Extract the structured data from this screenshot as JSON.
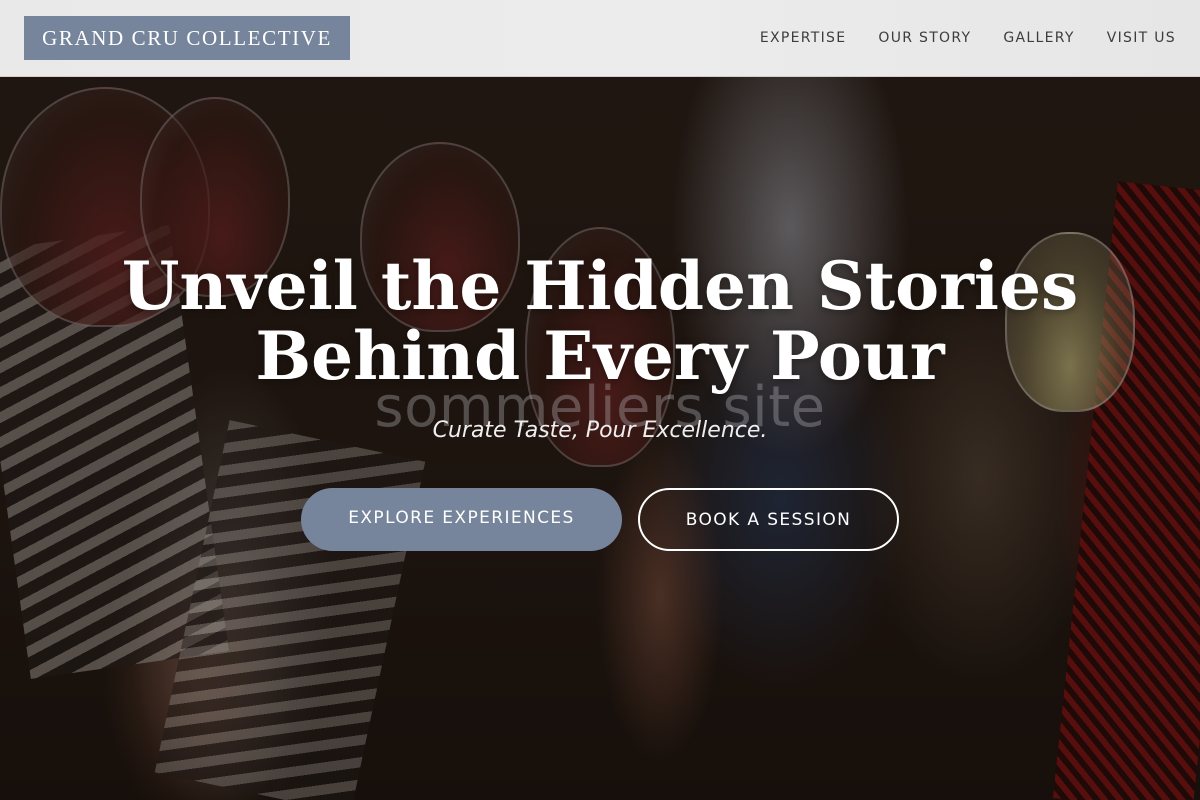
{
  "header": {
    "brand": "GRAND CRU COLLECTIVE",
    "nav": [
      "EXPERTISE",
      "OUR STORY",
      "GALLERY",
      "VISIT US"
    ]
  },
  "hero": {
    "title_line1": "Unveil the Hidden Stories",
    "title_line2": "Behind Every Pour",
    "watermark": "sommeliers site",
    "tagline": "Curate Taste, Pour Excellence.",
    "primary_button": "EXPLORE EXPERIENCES",
    "secondary_button": "BOOK A SESSION"
  },
  "colors": {
    "accent": "#76859b",
    "header_bg": "#eaeaea",
    "nav_text": "#3d3d3d",
    "hero_text": "#ffffff"
  }
}
